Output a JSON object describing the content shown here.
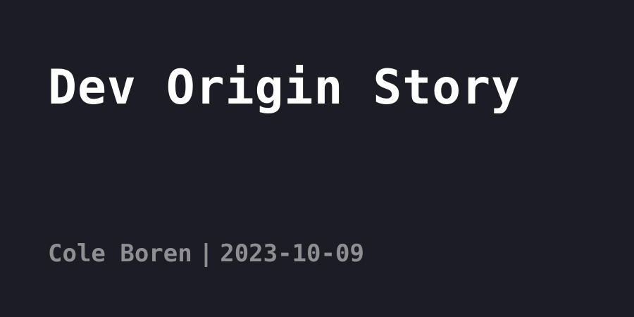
{
  "post": {
    "title": "Dev Origin Story",
    "author": "Cole Boren",
    "separator": "|",
    "date": "2023-10-09"
  },
  "colors": {
    "background": "#1b1c24",
    "title": "#ffffff",
    "meta": "#8f8f93"
  }
}
